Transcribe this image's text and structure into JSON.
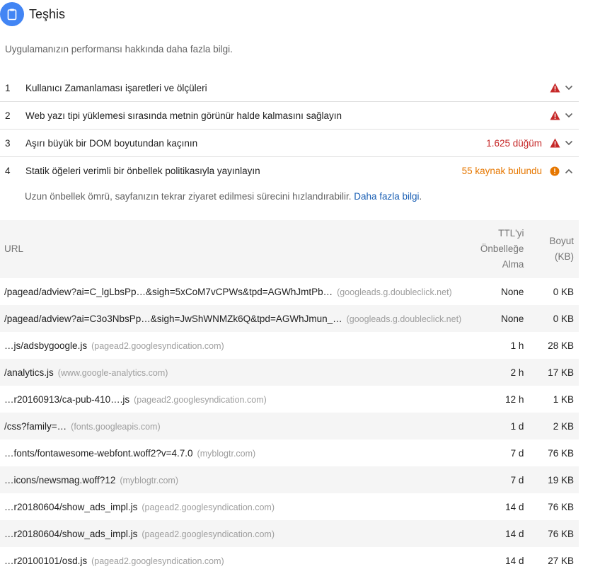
{
  "header": {
    "title": "Teşhis",
    "icon": "clipboard-icon"
  },
  "subtitle": "Uygulamanızın performansı hakkında daha fazla bilgi.",
  "audits": [
    {
      "num": "1",
      "title": "Kullanıcı Zamanlaması işaretleri ve ölçüleri",
      "value": "",
      "status": "fail",
      "expanded": false
    },
    {
      "num": "2",
      "title": "Web yazı tipi yüklemesi sırasında metnin görünür halde kalmasını sağlayın",
      "value": "",
      "status": "fail",
      "expanded": false
    },
    {
      "num": "3",
      "title": "Aşırı büyük bir DOM boyutundan kaçının",
      "value": "1.625 düğüm",
      "status": "fail",
      "expanded": false
    },
    {
      "num": "4",
      "title": "Statik öğeleri verimli bir önbellek politikasıyla yayınlayın",
      "value": "55 kaynak bulundu",
      "status": "average",
      "expanded": true
    }
  ],
  "details": {
    "description": "Uzun önbellek ömrü, sayfanızın tekrar ziyaret edilmesi sürecini hızlandırabilir.",
    "link": "Daha fazla bilgi",
    "period": ".",
    "headers": {
      "url": "URL",
      "ttl": [
        "TTL'yi",
        "Önbelleğe",
        "Alma"
      ],
      "size": [
        "Boyut",
        "(KB)"
      ]
    },
    "rows": [
      {
        "url": "/pagead/adview?ai=C_lgLbsPp…&sigh=5xCoM7vCPWs&tpd=AGWhJmtPb…",
        "host": "(googleads.g.doubleclick.net)",
        "ttl": "None",
        "size": "0 KB"
      },
      {
        "url": "/pagead/adview?ai=C3o3NbsPp…&sigh=JwShWNMZk6Q&tpd=AGWhJmun_…",
        "host": "(googleads.g.doubleclick.net)",
        "ttl": "None",
        "size": "0 KB"
      },
      {
        "url": "…js/adsbygoogle.js",
        "host": "(pagead2.googlesyndication.com)",
        "ttl": "1 h",
        "size": "28 KB"
      },
      {
        "url": "/analytics.js",
        "host": "(www.google-analytics.com)",
        "ttl": "2 h",
        "size": "17 KB"
      },
      {
        "url": "…r20160913/ca-pub-410….js",
        "host": "(pagead2.googlesyndication.com)",
        "ttl": "12 h",
        "size": "1 KB"
      },
      {
        "url": "/css?family=…",
        "host": "(fonts.googleapis.com)",
        "ttl": "1 d",
        "size": "2 KB"
      },
      {
        "url": "…fonts/fontawesome-webfont.woff2?v=4.7.0",
        "host": "(myblogtr.com)",
        "ttl": "7 d",
        "size": "76 KB"
      },
      {
        "url": "…icons/newsmag.woff?12",
        "host": "(myblogtr.com)",
        "ttl": "7 d",
        "size": "19 KB"
      },
      {
        "url": "…r20180604/show_ads_impl.js",
        "host": "(pagead2.googlesyndication.com)",
        "ttl": "14 d",
        "size": "76 KB"
      },
      {
        "url": "…r20180604/show_ads_impl.js",
        "host": "(pagead2.googlesyndication.com)",
        "ttl": "14 d",
        "size": "76 KB"
      },
      {
        "url": "…r20100101/osd.js",
        "host": "(pagead2.googlesyndication.com)",
        "ttl": "14 d",
        "size": "27 KB"
      }
    ]
  },
  "colors": {
    "accent": "#4285f4",
    "fail": "#c62828",
    "average": "#e67700",
    "link": "#1a5fb4"
  }
}
